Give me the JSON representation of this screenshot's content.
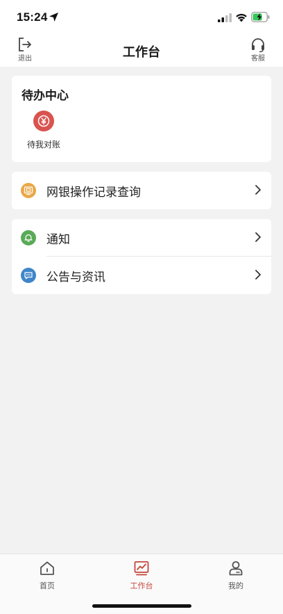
{
  "status_bar": {
    "time": "15:24",
    "icons": [
      "location-arrow-icon",
      "cellular-signal-icon",
      "wifi-icon",
      "battery-charging-icon"
    ]
  },
  "nav": {
    "title": "工作台",
    "left_label": "退出",
    "left_icon": "logout-icon",
    "right_label": "客服",
    "right_icon": "headset-icon"
  },
  "todo": {
    "title": "待办中心",
    "items": [
      {
        "label": "待我对账",
        "icon": "yen-icon",
        "color": "#d9534f"
      }
    ]
  },
  "menu": {
    "records": {
      "label": "网银操作记录查询",
      "icon": "screen-record-icon",
      "color": "#e9a84a"
    },
    "notify": {
      "label": "通知",
      "icon": "bell-icon",
      "color": "#5aaa57"
    },
    "news": {
      "label": "公告与资讯",
      "icon": "chat-bubble-icon",
      "color": "#3f86c9"
    }
  },
  "tabbar": {
    "tabs": [
      {
        "label": "首页",
        "icon": "home-icon",
        "active": false
      },
      {
        "label": "工作台",
        "icon": "chart-icon",
        "active": true
      },
      {
        "label": "我的",
        "icon": "user-icon",
        "active": false
      }
    ],
    "active_color": "#c4463a",
    "inactive_color": "#555555"
  }
}
